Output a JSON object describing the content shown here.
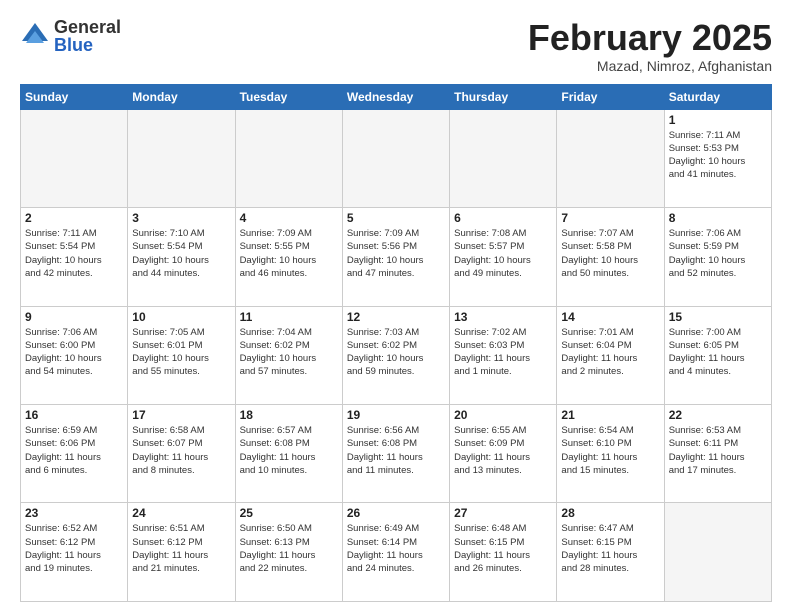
{
  "logo": {
    "general": "General",
    "blue": "Blue"
  },
  "header": {
    "month": "February 2025",
    "location": "Mazad, Nimroz, Afghanistan"
  },
  "weekdays": [
    "Sunday",
    "Monday",
    "Tuesday",
    "Wednesday",
    "Thursday",
    "Friday",
    "Saturday"
  ],
  "weeks": [
    [
      {
        "day": "",
        "info": ""
      },
      {
        "day": "",
        "info": ""
      },
      {
        "day": "",
        "info": ""
      },
      {
        "day": "",
        "info": ""
      },
      {
        "day": "",
        "info": ""
      },
      {
        "day": "",
        "info": ""
      },
      {
        "day": "1",
        "info": "Sunrise: 7:11 AM\nSunset: 5:53 PM\nDaylight: 10 hours\nand 41 minutes."
      }
    ],
    [
      {
        "day": "2",
        "info": "Sunrise: 7:11 AM\nSunset: 5:54 PM\nDaylight: 10 hours\nand 42 minutes."
      },
      {
        "day": "3",
        "info": "Sunrise: 7:10 AM\nSunset: 5:54 PM\nDaylight: 10 hours\nand 44 minutes."
      },
      {
        "day": "4",
        "info": "Sunrise: 7:09 AM\nSunset: 5:55 PM\nDaylight: 10 hours\nand 46 minutes."
      },
      {
        "day": "5",
        "info": "Sunrise: 7:09 AM\nSunset: 5:56 PM\nDaylight: 10 hours\nand 47 minutes."
      },
      {
        "day": "6",
        "info": "Sunrise: 7:08 AM\nSunset: 5:57 PM\nDaylight: 10 hours\nand 49 minutes."
      },
      {
        "day": "7",
        "info": "Sunrise: 7:07 AM\nSunset: 5:58 PM\nDaylight: 10 hours\nand 50 minutes."
      },
      {
        "day": "8",
        "info": "Sunrise: 7:06 AM\nSunset: 5:59 PM\nDaylight: 10 hours\nand 52 minutes."
      }
    ],
    [
      {
        "day": "9",
        "info": "Sunrise: 7:06 AM\nSunset: 6:00 PM\nDaylight: 10 hours\nand 54 minutes."
      },
      {
        "day": "10",
        "info": "Sunrise: 7:05 AM\nSunset: 6:01 PM\nDaylight: 10 hours\nand 55 minutes."
      },
      {
        "day": "11",
        "info": "Sunrise: 7:04 AM\nSunset: 6:02 PM\nDaylight: 10 hours\nand 57 minutes."
      },
      {
        "day": "12",
        "info": "Sunrise: 7:03 AM\nSunset: 6:02 PM\nDaylight: 10 hours\nand 59 minutes."
      },
      {
        "day": "13",
        "info": "Sunrise: 7:02 AM\nSunset: 6:03 PM\nDaylight: 11 hours\nand 1 minute."
      },
      {
        "day": "14",
        "info": "Sunrise: 7:01 AM\nSunset: 6:04 PM\nDaylight: 11 hours\nand 2 minutes."
      },
      {
        "day": "15",
        "info": "Sunrise: 7:00 AM\nSunset: 6:05 PM\nDaylight: 11 hours\nand 4 minutes."
      }
    ],
    [
      {
        "day": "16",
        "info": "Sunrise: 6:59 AM\nSunset: 6:06 PM\nDaylight: 11 hours\nand 6 minutes."
      },
      {
        "day": "17",
        "info": "Sunrise: 6:58 AM\nSunset: 6:07 PM\nDaylight: 11 hours\nand 8 minutes."
      },
      {
        "day": "18",
        "info": "Sunrise: 6:57 AM\nSunset: 6:08 PM\nDaylight: 11 hours\nand 10 minutes."
      },
      {
        "day": "19",
        "info": "Sunrise: 6:56 AM\nSunset: 6:08 PM\nDaylight: 11 hours\nand 11 minutes."
      },
      {
        "day": "20",
        "info": "Sunrise: 6:55 AM\nSunset: 6:09 PM\nDaylight: 11 hours\nand 13 minutes."
      },
      {
        "day": "21",
        "info": "Sunrise: 6:54 AM\nSunset: 6:10 PM\nDaylight: 11 hours\nand 15 minutes."
      },
      {
        "day": "22",
        "info": "Sunrise: 6:53 AM\nSunset: 6:11 PM\nDaylight: 11 hours\nand 17 minutes."
      }
    ],
    [
      {
        "day": "23",
        "info": "Sunrise: 6:52 AM\nSunset: 6:12 PM\nDaylight: 11 hours\nand 19 minutes."
      },
      {
        "day": "24",
        "info": "Sunrise: 6:51 AM\nSunset: 6:12 PM\nDaylight: 11 hours\nand 21 minutes."
      },
      {
        "day": "25",
        "info": "Sunrise: 6:50 AM\nSunset: 6:13 PM\nDaylight: 11 hours\nand 22 minutes."
      },
      {
        "day": "26",
        "info": "Sunrise: 6:49 AM\nSunset: 6:14 PM\nDaylight: 11 hours\nand 24 minutes."
      },
      {
        "day": "27",
        "info": "Sunrise: 6:48 AM\nSunset: 6:15 PM\nDaylight: 11 hours\nand 26 minutes."
      },
      {
        "day": "28",
        "info": "Sunrise: 6:47 AM\nSunset: 6:15 PM\nDaylight: 11 hours\nand 28 minutes."
      },
      {
        "day": "",
        "info": ""
      }
    ]
  ]
}
